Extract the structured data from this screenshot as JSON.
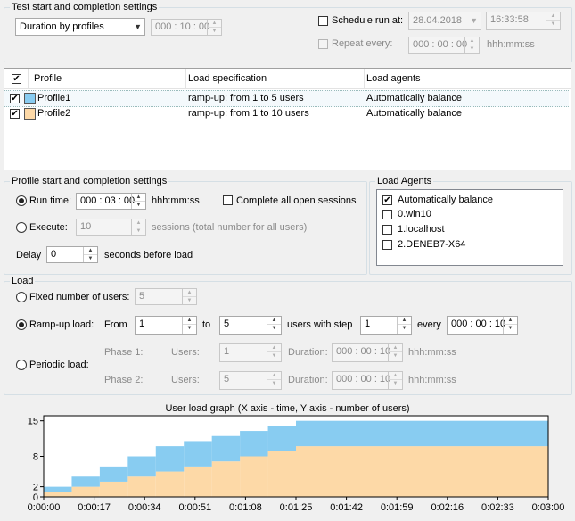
{
  "test_settings": {
    "legend": "Test start and completion settings",
    "mode_select": "Duration by profiles",
    "duration_value": "000 : 10 : 00",
    "schedule_label": "Schedule run at:",
    "schedule_date": "28.04.2018",
    "schedule_time": "16:33:58",
    "repeat_label": "Repeat every:",
    "repeat_value": "000 : 00 : 00",
    "repeat_unit": "hhh:mm:ss"
  },
  "profiles_table": {
    "columns": [
      "Profile",
      "Load specification",
      "Load agents"
    ],
    "rows": [
      {
        "checked": "✔",
        "color": "#88ccf1",
        "name": "Profile1",
        "spec": "ramp-up: from 1 to 5 users",
        "agents": "Automatically balance"
      },
      {
        "checked": "✔",
        "color": "#fdd9a7",
        "name": "Profile2",
        "spec": "ramp-up: from 1 to 10 users",
        "agents": "Automatically balance"
      }
    ]
  },
  "profile_settings": {
    "legend": "Profile start and completion settings",
    "run_time_label": "Run time:",
    "run_time_value": "000 : 03 : 00",
    "run_time_unit": "hhh:mm:ss",
    "complete_sessions_label": "Complete all open sessions",
    "execute_label": "Execute:",
    "execute_value": "10",
    "execute_unit": "sessions (total number for all users)",
    "delay_label": "Delay",
    "delay_value": "0",
    "delay_unit": "seconds before load"
  },
  "load_agents": {
    "legend": "Load Agents",
    "items": [
      {
        "label": "Automatically balance",
        "checked": "✔"
      },
      {
        "label": "0.win10",
        "checked": ""
      },
      {
        "label": "1.localhost",
        "checked": ""
      },
      {
        "label": "2.DENEB7-X64",
        "checked": ""
      }
    ]
  },
  "load": {
    "legend": "Load",
    "fixed_label": "Fixed number of users:",
    "fixed_value": "5",
    "rampup_label": "Ramp-up load:",
    "from_label": "From",
    "from_value": "1",
    "to_label": "to",
    "to_value": "5",
    "step_label": "users with step",
    "step_value": "1",
    "every_label": "every",
    "every_value": "000 : 00 : 10",
    "periodic_label": "Periodic load:",
    "phase1_label": "Phase 1:",
    "phase2_label": "Phase 2:",
    "users_label": "Users:",
    "phase1_users": "1",
    "phase2_users": "5",
    "duration_label": "Duration:",
    "phase1_duration": "000 : 00 : 10",
    "phase2_duration": "000 : 00 : 10",
    "duration_unit": "hhh:mm:ss"
  },
  "chart_data": {
    "type": "area",
    "title": "User load graph (X axis - time, Y axis - number of users)",
    "xlabel": "",
    "ylabel": "",
    "x_ticks": [
      "0:00:00",
      "0:00:17",
      "0:00:34",
      "0:00:51",
      "0:01:08",
      "0:01:25",
      "0:01:42",
      "0:01:59",
      "0:02:16",
      "0:02:33",
      "0:03:00"
    ],
    "y_ticks": [
      "0",
      "2",
      "8",
      "15"
    ],
    "ylim": [
      0,
      16
    ],
    "xlim_seconds": [
      0,
      180
    ],
    "stacked": true,
    "colors": {
      "Profile1": "#88ccf1",
      "Profile2": "#fdd9a7"
    },
    "series": [
      {
        "name": "Profile1",
        "color": "#88ccf1",
        "steps": [
          [
            0,
            1
          ],
          [
            10,
            2
          ],
          [
            20,
            3
          ],
          [
            30,
            4
          ],
          [
            40,
            5
          ]
        ]
      },
      {
        "name": "Profile2",
        "color": "#fdd9a7",
        "steps": [
          [
            0,
            1
          ],
          [
            10,
            2
          ],
          [
            20,
            3
          ],
          [
            30,
            4
          ],
          [
            40,
            5
          ],
          [
            50,
            6
          ],
          [
            60,
            7
          ],
          [
            70,
            8
          ],
          [
            80,
            9
          ],
          [
            90,
            10
          ]
        ]
      }
    ]
  }
}
